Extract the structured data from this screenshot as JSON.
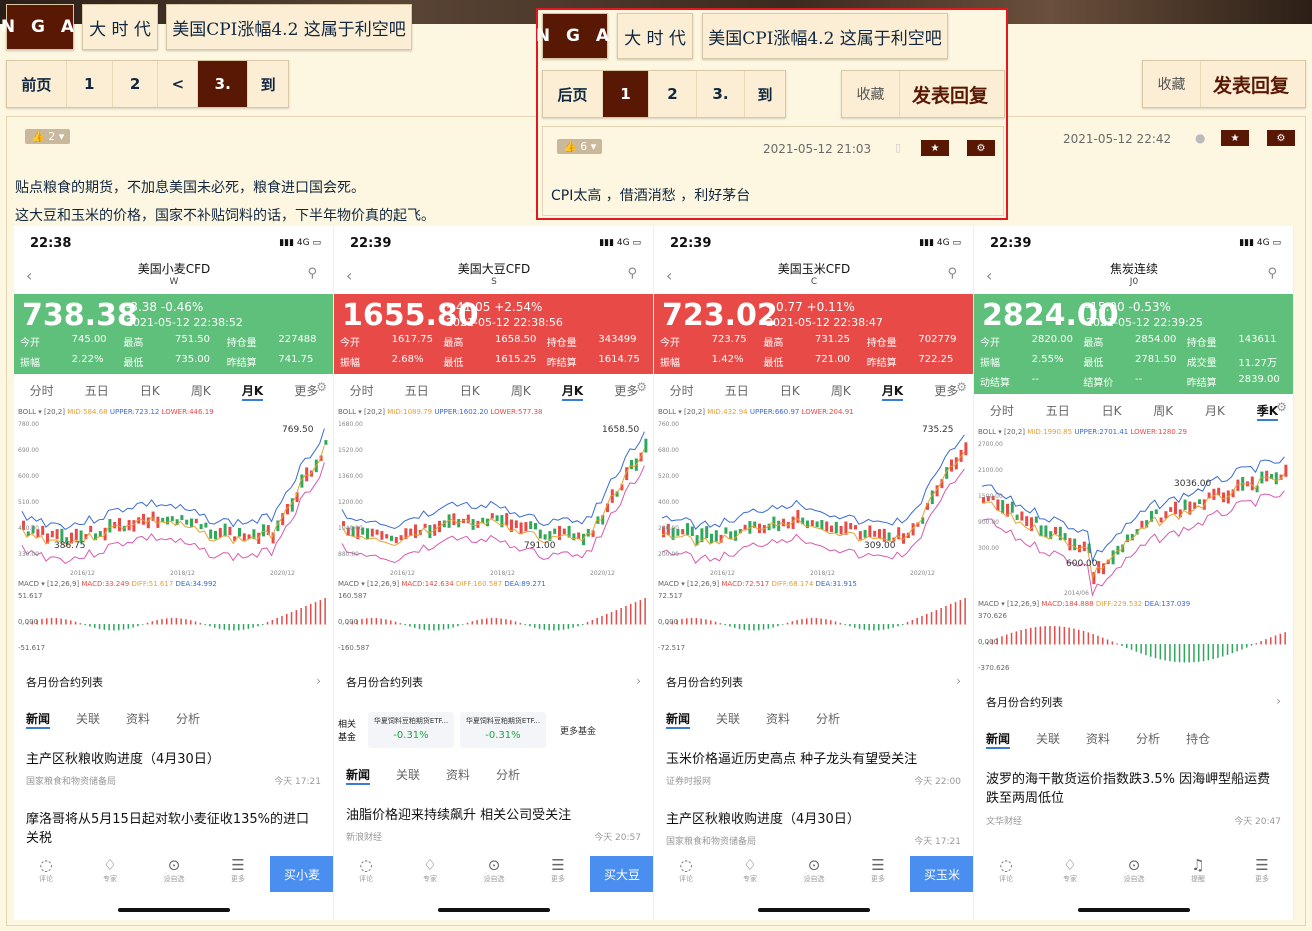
{
  "nav": {
    "logo": "N G A",
    "forum": "大 时 代",
    "thread_title": "美国CPI涨幅4.2 这属于利空吧"
  },
  "pager_top": {
    "prev": "前页",
    "p1": "1",
    "p2": "2",
    "lt": "<",
    "current": "3.",
    "goto": "到"
  },
  "actions": {
    "favorite": "收藏",
    "reply": "发表回复"
  },
  "post": {
    "likes": "2",
    "date": "2021-05-12 22:42",
    "line1": "贴点粮食的期货，不加息美国未必死，粮食进口国会死。",
    "line2": "这大豆和玉米的价格，国家不补贴饲料的话，下半年物价真的起飞。"
  },
  "overlay": {
    "logo": "N G A",
    "forum": "大 时 代",
    "thread_title": "美国CPI涨幅4.2 这属于利空吧",
    "pager": {
      "next": "后页",
      "p1": "1",
      "p2": "2",
      "p3": "3.",
      "goto": "到"
    },
    "favorite": "收藏",
    "reply": "发表回复",
    "likes": "6",
    "date": "2021-05-12 21:03",
    "content": "CPI太高 ，借酒消愁 ，利好茅台"
  },
  "phones": [
    {
      "time": "22:38",
      "net": "4G",
      "name": "美国小麦CFD",
      "code": "W",
      "price": "738.38",
      "chg": "-3.38  -0.46%",
      "qtime": "2021-05-12 22:38:52",
      "row1": [
        "今开",
        "745.00",
        "最高",
        "751.50",
        "持仓量",
        "227488"
      ],
      "row2": [
        "振幅",
        "2.22%",
        "最低",
        "735.00",
        "昨结算",
        "741.75"
      ],
      "periods": [
        "分时",
        "五日",
        "日K",
        "周K",
        "月K",
        "更多"
      ],
      "boll": "BOLL",
      "boll_params": "[20,2]",
      "mid": "MID:584.68",
      "upper": "UPPER:723.12",
      "lower": "LOWER:446.19",
      "yaxis": [
        "780.00",
        "690.00",
        "600.00",
        "510.00",
        "420.00",
        "330.00"
      ],
      "xaxis": [
        "2016/12",
        "2018/12",
        "2020/12"
      ],
      "hi": "769.50",
      "lo": "386.75",
      "macd": "MACD",
      "macd_params": "[12,26,9]",
      "macdv": "MACD:33.249",
      "dif": "DIFF:51.617",
      "dea": "DEA:34.992",
      "m_top": "51.617",
      "m_zero": "0.000",
      "m_bot": "-51.617",
      "list": "各月份合约列表",
      "ntabs": [
        "新闻",
        "关联",
        "资料",
        "分析"
      ],
      "news": [
        {
          "t": "主产区秋粮收购进度（4月30日）",
          "s": "国家粮食和物资储备局",
          "d": "今天 17:21"
        },
        {
          "t": "摩洛哥将从5月15日起对软小麦征收135%的进口关税",
          "s": "",
          "d": ""
        }
      ],
      "bnav": [
        "评论",
        "专家",
        "设自选",
        "更多"
      ],
      "buy": "买小麦"
    },
    {
      "time": "22:39",
      "net": "4G",
      "name": "美国大豆CFD",
      "code": "S",
      "price": "1655.80",
      "chg": "+41.05  +2.54%",
      "qtime": "2021-05-12 22:38:56",
      "row1": [
        "今开",
        "1617.75",
        "最高",
        "1658.50",
        "持仓量",
        "343499"
      ],
      "row2": [
        "振幅",
        "2.68%",
        "最低",
        "1615.25",
        "昨结算",
        "1614.75"
      ],
      "periods": [
        "分时",
        "五日",
        "日K",
        "周K",
        "月K",
        "更多"
      ],
      "boll": "BOLL",
      "boll_params": "[20,2]",
      "mid": "MID:1089.79",
      "upper": "UPPER:1602.20",
      "lower": "LOWER:577.38",
      "yaxis": [
        "1680.00",
        "1520.00",
        "1360.00",
        "1200.00",
        "1040.00",
        "880.00"
      ],
      "xaxis": [
        "2016/12",
        "2018/12",
        "2020/12"
      ],
      "hi": "1658.50",
      "lo": "791.00",
      "macd": "MACD",
      "macd_params": "[12,26,9]",
      "macdv": "MACD:142.634",
      "dif": "DIFF:160.587",
      "dea": "DEA:89.271",
      "m_top": "160.587",
      "m_zero": "0.000",
      "m_bot": "-160.587",
      "list": "各月份合约列表",
      "fund_label": "相关基金",
      "funds": [
        {
          "n": "华夏饲料豆粕期货ETF...",
          "v": "-0.31%"
        },
        {
          "n": "华夏饲料豆粕期货ETF...",
          "v": "-0.31%"
        }
      ],
      "fund_more": "更多基金",
      "ntabs": [
        "新闻",
        "关联",
        "资料",
        "分析"
      ],
      "news": [
        {
          "t": "油脂价格迎来持续飙升 相关公司受关注",
          "s": "新浪财经",
          "d": "今天 20:57"
        }
      ],
      "bnav": [
        "评论",
        "专家",
        "设自选",
        "更多"
      ],
      "buy": "买大豆"
    },
    {
      "time": "22:39",
      "net": "4G",
      "name": "美国玉米CFD",
      "code": "C",
      "price": "723.02",
      "chg": "+0.77  +0.11%",
      "qtime": "2021-05-12 22:38:47",
      "row1": [
        "今开",
        "723.75",
        "最高",
        "731.25",
        "持仓量",
        "702779"
      ],
      "row2": [
        "振幅",
        "1.42%",
        "最低",
        "721.00",
        "昨结算",
        "722.25"
      ],
      "periods": [
        "分时",
        "五日",
        "日K",
        "周K",
        "月K",
        "更多"
      ],
      "boll": "BOLL",
      "boll_params": "[20,2]",
      "mid": "MID:432.94",
      "upper": "UPPER:660.97",
      "lower": "LOWER:204.91",
      "yaxis": [
        "760.00",
        "680.00",
        "520.00",
        "400.00",
        "280.00",
        "200.00"
      ],
      "xaxis": [
        "2016/12",
        "2018/12",
        "2020/12"
      ],
      "hi": "735.25",
      "lo": "309.00",
      "macd": "MACD",
      "macd_params": "[12,26,9]",
      "macdv": "MACD:72.517",
      "dif": "DIFF:68.174",
      "dea": "DEA:31.915",
      "m_top": "72.517",
      "m_zero": "0.000",
      "m_bot": "-72.517",
      "list": "各月份合约列表",
      "ntabs": [
        "新闻",
        "关联",
        "资料",
        "分析"
      ],
      "news": [
        {
          "t": "玉米价格逼近历史高点 种子龙头有望受关注",
          "s": "证券时报网",
          "d": "今天 22:00"
        },
        {
          "t": "主产区秋粮收购进度（4月30日）",
          "s": "国家粮食和物资储备局",
          "d": "今天 17:21"
        }
      ],
      "bnav": [
        "评论",
        "专家",
        "设自选",
        "更多"
      ],
      "buy": "买玉米"
    },
    {
      "time": "22:39",
      "net": "4G",
      "name": "焦炭连续",
      "code": "J0",
      "price": "2824.00",
      "chg": "-15.00  -0.53%",
      "qtime": "2021-05-12 22:39:25",
      "row1": [
        "今开",
        "2820.00",
        "最高",
        "2854.00",
        "持仓量",
        "143611"
      ],
      "row2": [
        "振幅",
        "2.55%",
        "最低",
        "2781.50",
        "成交量",
        "11.27万"
      ],
      "row3": [
        "动结算",
        "--",
        "结算价",
        "--",
        "昨结算",
        "2839.00"
      ],
      "periods": [
        "分时",
        "五日",
        "日K",
        "周K",
        "月K",
        "季K"
      ],
      "boll": "BOLL",
      "boll_params": "[20,2]",
      "mid": "MID:1990.85",
      "upper": "UPPER:2701.41",
      "lower": "LOWER:1280.29",
      "yaxis": [
        "2700.00",
        "2100.00",
        "1500.00",
        "900.00",
        "300.00"
      ],
      "xaxis": [
        "2014/06"
      ],
      "hi": "3036.00",
      "lo": "600.00",
      "macd": "MACD",
      "macd_params": "[12,26,9]",
      "macdv": "MACD:184.888",
      "dif": "DIFF:229.532",
      "dea": "DEA:137.039",
      "m_top": "370.626",
      "m_zero": "0.000",
      "m_bot": "-370.626",
      "list": "各月份合约列表",
      "ntabs": [
        "新闻",
        "关联",
        "资料",
        "分析",
        "持仓"
      ],
      "news": [
        {
          "t": "波罗的海干散货运价指数跌3.5% 因海岬型船运费跌至两周低位",
          "s": "文华财经",
          "d": "今天 20:47"
        }
      ],
      "bnav": [
        "评论",
        "专家",
        "设自选",
        "提醒",
        "更多"
      ],
      "buy": ""
    }
  ]
}
